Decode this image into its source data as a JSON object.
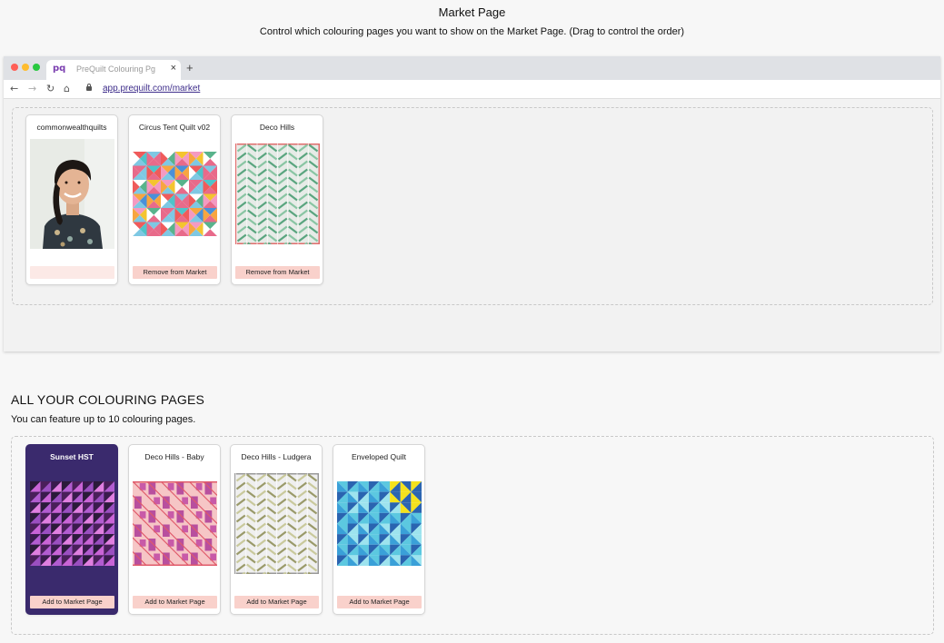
{
  "header": {
    "title": "Market Page",
    "subtitle": "Control which colouring pages you want to show on the Market Page. (Drag to control the order)"
  },
  "browser": {
    "tab_favicon": "pq",
    "tab_title": "PreQuilt Colouring Pg",
    "tab_close": "×",
    "new_tab": "+",
    "url": "app.prequilt.com/market",
    "icons": [
      "back-arrow-icon",
      "forward-arrow-icon",
      "reload-icon",
      "home-icon",
      "lock-icon"
    ]
  },
  "market_cards": [
    {
      "title": "commonwealthquilts",
      "button": ""
    },
    {
      "title": "Circus Tent Quilt v02",
      "button": "Remove from Market"
    },
    {
      "title": "Deco Hills",
      "button": "Remove from Market"
    }
  ],
  "all_pages": {
    "heading": "ALL YOUR COLOURING PAGES",
    "subtitle": "You can feature up to 10 colouring pages.",
    "cards": [
      {
        "title": "Sunset HST",
        "button": "Add to Market Page",
        "selected": true
      },
      {
        "title": "Deco Hills - Baby",
        "button": "Add to Market Page",
        "selected": false
      },
      {
        "title": "Deco Hills - Ludgera",
        "button": "Add to Market Page",
        "selected": false
      },
      {
        "title": "Enveloped Quilt",
        "button": "Add to Market Page",
        "selected": false
      }
    ]
  },
  "colors": {
    "selected_card": "#3a2a6d",
    "button_bg": "#f9d1cb",
    "link": "#3d2c8a"
  }
}
